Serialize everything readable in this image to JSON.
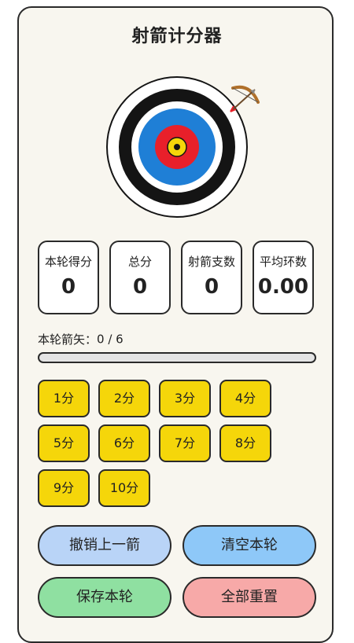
{
  "app": {
    "title": "射箭计分器"
  },
  "stats": [
    {
      "label": "本轮得分",
      "value": "0"
    },
    {
      "label": "总分",
      "value": "0"
    },
    {
      "label": "射箭支数",
      "value": "0"
    },
    {
      "label": "平均环数",
      "value": "0.00"
    }
  ],
  "round": {
    "label": "本轮箭矢：",
    "count": "0 / 6",
    "progress_fraction": 0
  },
  "score_buttons": [
    {
      "label": "1分"
    },
    {
      "label": "2分"
    },
    {
      "label": "3分"
    },
    {
      "label": "4分"
    },
    {
      "label": "5分"
    },
    {
      "label": "6分"
    },
    {
      "label": "7分"
    },
    {
      "label": "8分"
    },
    {
      "label": "9分"
    },
    {
      "label": "10分"
    }
  ],
  "actions": {
    "undo": "撤销上一箭",
    "clear": "清空本轮",
    "save": "保存本轮",
    "reset": "全部重置"
  },
  "colors": {
    "score_button": "#f5d60a",
    "undo": "#b9d4f7",
    "clear": "#8ec8f8",
    "save": "#8fe0a1",
    "reset": "#f7a9a8",
    "target_black": "#141414",
    "target_blue": "#1f7fd6",
    "target_red": "#e8202a",
    "target_yellow": "#f5d60a"
  },
  "icons": {
    "target": "archery-target-icon",
    "bow": "bow-and-arrow-icon"
  }
}
